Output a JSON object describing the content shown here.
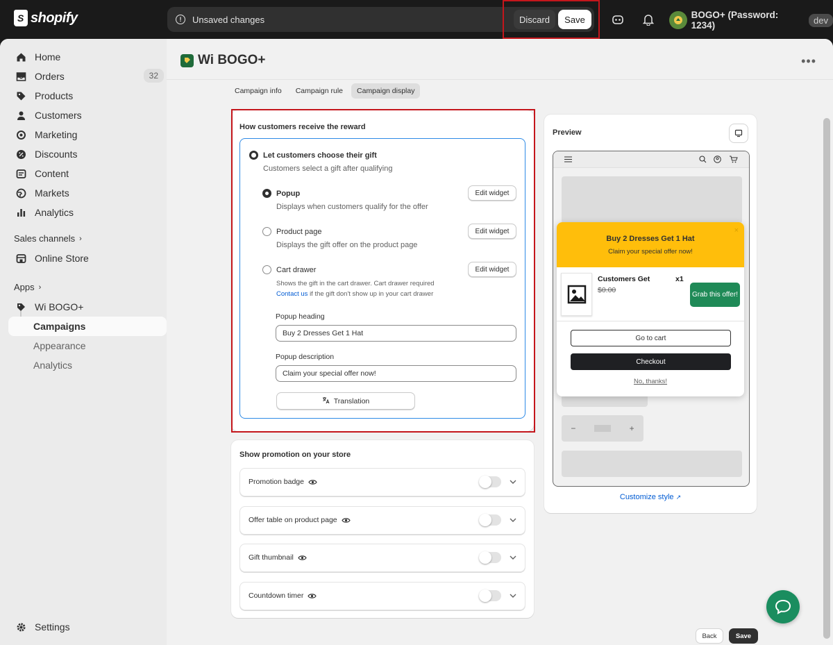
{
  "topbar": {
    "brand": "shopify",
    "unsaved_text": "Unsaved changes",
    "discard_label": "Discard",
    "save_label": "Save",
    "store_name": "BOGO+ (Password: 1234)",
    "store_badge": "dev"
  },
  "sidebar": {
    "items": [
      {
        "label": "Home",
        "icon": "home-icon"
      },
      {
        "label": "Orders",
        "icon": "orders-icon",
        "badge": "32"
      },
      {
        "label": "Products",
        "icon": "tag-icon"
      },
      {
        "label": "Customers",
        "icon": "person-icon"
      },
      {
        "label": "Marketing",
        "icon": "target-icon"
      },
      {
        "label": "Discounts",
        "icon": "discount-icon"
      },
      {
        "label": "Content",
        "icon": "content-icon"
      },
      {
        "label": "Markets",
        "icon": "globe-icon"
      },
      {
        "label": "Analytics",
        "icon": "bar-chart-icon"
      }
    ],
    "sales_channels_heading": "Sales channels",
    "online_store": "Online Store",
    "apps_heading": "Apps",
    "app_name": "Wi BOGO+",
    "app_sub": [
      "Campaigns",
      "Appearance",
      "Analytics"
    ],
    "settings": "Settings"
  },
  "page": {
    "title": "Wi BOGO+",
    "more_icon": "more-horizontal-icon",
    "tabs": [
      "Campaign info",
      "Campaign rule",
      "Campaign display"
    ],
    "selected_tab": "Campaign display"
  },
  "reward": {
    "title": "How customers receive the reward",
    "choose_label": "Let customers choose their gift",
    "choose_desc": "Customers select a gift after qualifying",
    "options": [
      {
        "label": "Popup",
        "desc": "Displays when customers qualify for the offer",
        "button": "Edit widget",
        "selected": true
      },
      {
        "label": "Product page",
        "desc": "Displays the gift offer on the product page",
        "button": "Edit widget",
        "selected": false
      },
      {
        "label": "Cart drawer",
        "desc": "Shows the gift in the cart drawer. Cart drawer required",
        "link": "Contact us",
        "desc2": "if the gift don't show up in your cart drawer",
        "button": "Edit widget",
        "selected": false
      }
    ],
    "heading_label": "Popup heading",
    "heading_value": "Buy 2 Dresses Get 1 Hat",
    "desc_label": "Popup description",
    "desc_value": "Claim your special offer now!",
    "translation_label": "Translation"
  },
  "promotion": {
    "title": "Show promotion on your store",
    "rows": [
      {
        "label": "Promotion badge",
        "enabled": false
      },
      {
        "label": "Offer table on product page",
        "enabled": false
      },
      {
        "label": "Gift thumbnail",
        "enabled": false
      },
      {
        "label": "Countdown timer",
        "enabled": false
      }
    ]
  },
  "preview": {
    "title": "Preview",
    "popup_heading": "Buy 2 Dresses Get 1 Hat",
    "popup_desc": "Claim your special offer now!",
    "product_title": "Customers Get",
    "product_price": "$0.00",
    "product_qty": "x1",
    "grab_label": "Grab this offer!",
    "go_to_cart": "Go to cart",
    "checkout": "Checkout",
    "no_thanks": "No, thanks!",
    "customize_link": "Customize style",
    "stepper_minus": "−",
    "stepper_plus": "+"
  },
  "footer": {
    "back": "Back",
    "save": "Save"
  },
  "colors": {
    "popup_header": "#ffbe0b",
    "grab_button": "#1f8a57",
    "highlight_border": "#c4161c",
    "focus_border": "#2d8ae6"
  }
}
